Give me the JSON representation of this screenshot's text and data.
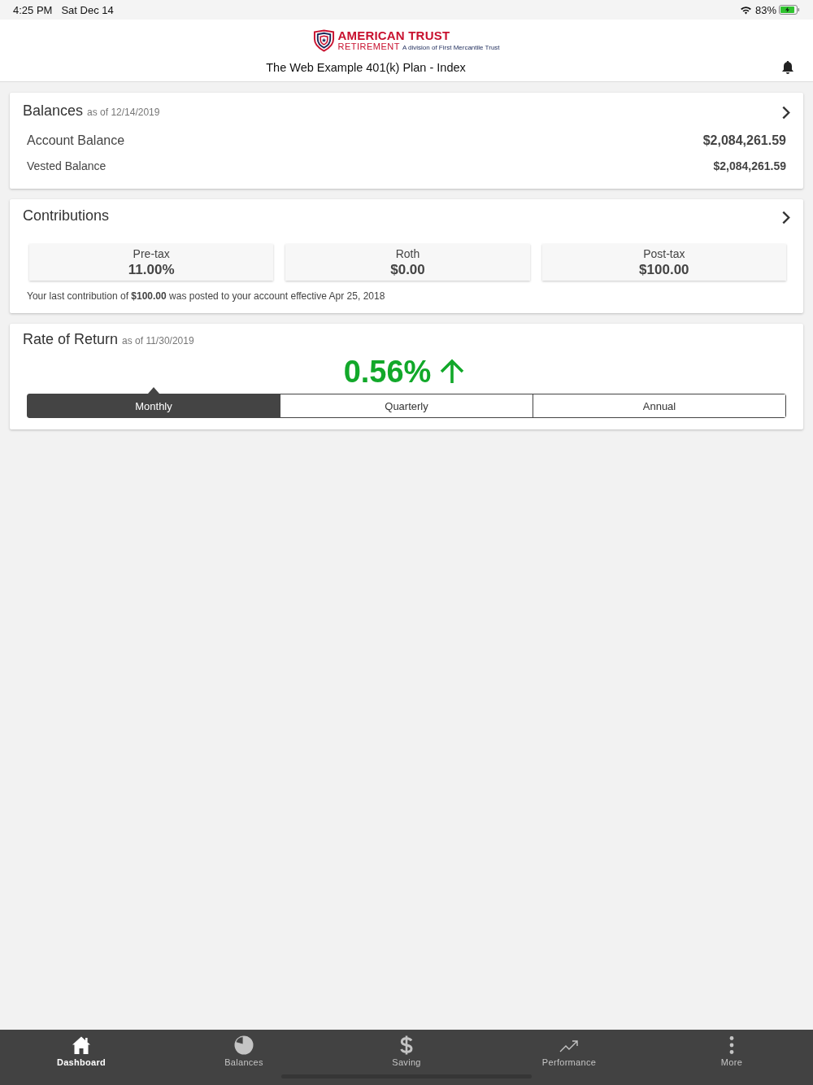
{
  "status_bar": {
    "time": "4:25 PM",
    "date": "Sat Dec 14",
    "battery": "83%"
  },
  "header": {
    "logo": {
      "name": "AMERICAN TRUST",
      "sub": "RETIREMENT",
      "tagline": "A division of First Mercantile Trust"
    },
    "title": "The Web Example 401(k) Plan - Index"
  },
  "balances": {
    "title": "Balances",
    "as_of": "as of 12/14/2019",
    "rows": [
      {
        "kind": "primary",
        "label": "Account Balance",
        "value": "$2,084,261.59"
      },
      {
        "kind": "secondary",
        "label": "Vested Balance",
        "value": "$2,084,261.59"
      }
    ]
  },
  "contributions": {
    "title": "Contributions",
    "tiles": [
      {
        "label": "Pre-tax",
        "value": "11.00%"
      },
      {
        "label": "Roth",
        "value": "$0.00"
      },
      {
        "label": "Post-tax",
        "value": "$100.00"
      }
    ],
    "note": "Your last contribution of **$100.00** was posted to your account effective Apr 25, 2018"
  },
  "rate_of_return": {
    "title": "Rate of Return",
    "as_of": "as of 11/30/2019",
    "value": "0.56%",
    "rising": true,
    "tabs": [
      {
        "label": "Monthly",
        "selected": true
      },
      {
        "label": "Quarterly",
        "selected": false
      },
      {
        "label": "Annual",
        "selected": false
      }
    ]
  },
  "tab_bar": [
    {
      "kind": "home",
      "label": "Dashboard",
      "selected": true
    },
    {
      "kind": "pie",
      "label": "Balances",
      "selected": false
    },
    {
      "kind": "dollar",
      "label": "Saving",
      "selected": false
    },
    {
      "kind": "trend",
      "label": "Performance",
      "selected": false
    },
    {
      "kind": "more",
      "label": "More",
      "selected": false
    }
  ]
}
